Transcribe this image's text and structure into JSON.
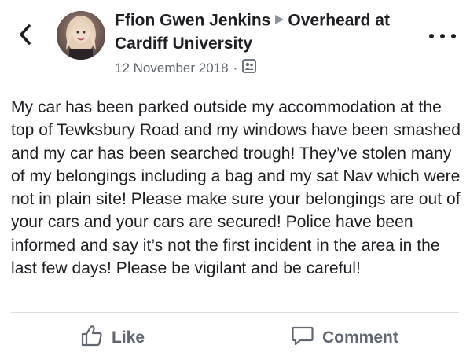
{
  "header": {
    "author": "Ffion Gwen Jenkins",
    "group": "Overheard at Cardiff University",
    "date": "12 November 2018",
    "separator": "·"
  },
  "post": {
    "text": "My car has been parked outside my accommodation at the top of Tewksbury Road and my windows have been smashed and my car has been searched trough! They’ve stolen many of my belongings including a bag and my sat Nav which were not in plain site! Please make sure your belongings are out of your cars and your cars are secured! Police have been informed and say it’s not the first incident in the area in the last few days! Please be vigilant and be careful!"
  },
  "actions": {
    "like_label": "Like",
    "comment_label": "Comment"
  },
  "icons": {
    "back": "chevron-left-icon",
    "arrow": "triangle-right-icon",
    "audience": "group-audience-icon",
    "more": "more-dots-icon",
    "like": "thumbs-up-icon",
    "comment": "speech-bubble-icon"
  },
  "colors": {
    "text": "#1c1e21",
    "secondary": "#616770",
    "action": "#606770",
    "divider": "#dadde1"
  }
}
